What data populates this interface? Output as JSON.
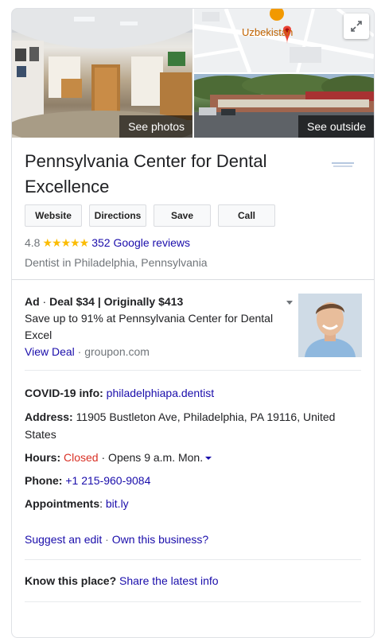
{
  "photos": {
    "see_photos": "See photos",
    "see_outside": "See outside",
    "map_label": "Uzbekistan"
  },
  "business": {
    "name": "Pennsylvania Center for Dental Excellence",
    "category": "Dentist in Philadelphia, Pennsylvania",
    "rating": "4.8",
    "stars": "★★★★★",
    "reviews_link": "352 Google reviews"
  },
  "actions": {
    "website": "Website",
    "directions": "Directions",
    "save": "Save",
    "call": "Call"
  },
  "ad": {
    "label": "Ad",
    "separator": " · ",
    "headline": "Deal $34 | Originally $413",
    "description": "Save up to 91% at Pennsylvania Center for Dental Excel",
    "link": "View Deal",
    "source": " · groupon.com"
  },
  "details": {
    "covid_label": "COVID-19 info:",
    "covid_link": "philadelphiapa.dentist",
    "address_label": "Address:",
    "address": "11905 Bustleton Ave, Philadelphia, PA 19116, United States",
    "hours_label": "Hours:",
    "hours_status": "Closed",
    "hours_next": " · Opens 9 a.m. Mon.",
    "phone_label": "Phone:",
    "phone": "+1 215-960-9084",
    "appointments_label": "Appointments",
    "appointments_link": "bit.ly"
  },
  "footer": {
    "suggest_edit": "Suggest an edit",
    "dot": " · ",
    "own_business": "Own this business?",
    "know_label": "Know this place?",
    "share_link": "Share the latest info"
  },
  "colors": {
    "link": "#1a0dab",
    "closed": "#d93025",
    "star": "#fbbc04",
    "map_pin": "#ea4335"
  }
}
